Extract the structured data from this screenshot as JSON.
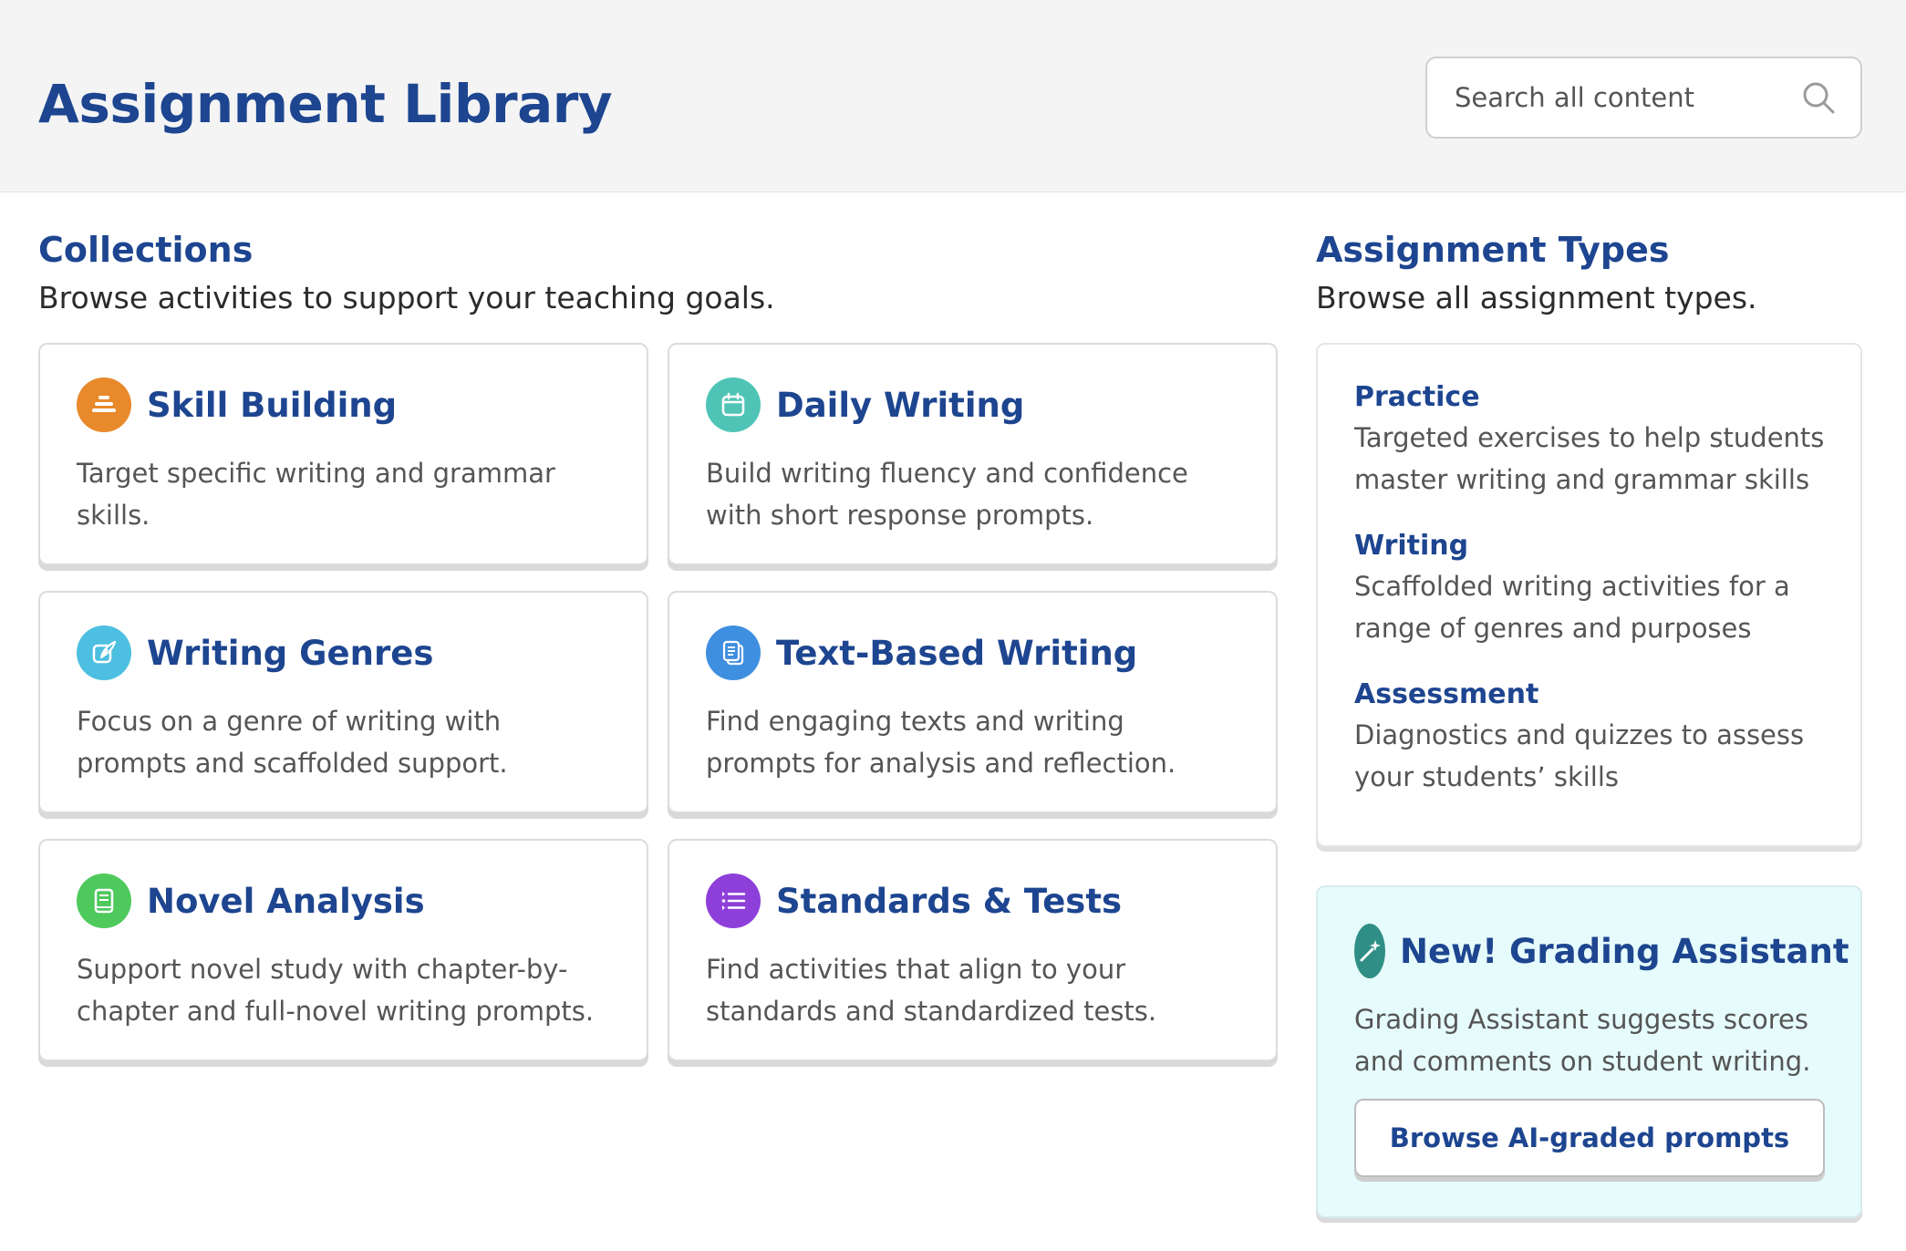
{
  "header": {
    "title": "Assignment Library",
    "search_placeholder": "Search all content"
  },
  "collections": {
    "title": "Collections",
    "subtitle": "Browse activities to support your teaching goals.",
    "cards": [
      {
        "title": "Skill Building",
        "description": "Target specific writing and grammar skills.",
        "icon": "layers-icon",
        "color": "#e8892b"
      },
      {
        "title": "Daily Writing",
        "description": "Build writing fluency and confidence with short response prompts.",
        "icon": "calendar-icon",
        "color": "#4fc4b6"
      },
      {
        "title": "Writing Genres",
        "description": "Focus on a genre of writing with prompts and scaffolded support.",
        "icon": "quill-icon",
        "color": "#4dbfe0"
      },
      {
        "title": "Text-Based Writing",
        "description": "Find engaging texts and writing prompts for analysis and reflection.",
        "icon": "documents-icon",
        "color": "#3f8fe0"
      },
      {
        "title": "Novel Analysis",
        "description": "Support novel study with chapter-by-chapter and full-novel writing prompts.",
        "icon": "book-icon",
        "color": "#4ec95c"
      },
      {
        "title": "Standards & Tests",
        "description": "Find activities that align to your standards and standardized tests.",
        "icon": "checklist-icon",
        "color": "#8e3fd9"
      }
    ]
  },
  "assignment_types": {
    "title": "Assignment Types",
    "subtitle": "Browse all assignment types.",
    "items": [
      {
        "title": "Practice",
        "description": "Targeted exercises to help students master writing and grammar skills"
      },
      {
        "title": "Writing",
        "description": "Scaffolded writing activities for a range of genres and purposes"
      },
      {
        "title": "Assessment",
        "description": "Diagnostics and quizzes to assess your students’ skills"
      }
    ]
  },
  "grading_assistant": {
    "title": "New! Grading Assistant",
    "description": "Grading Assistant suggests scores and comments on student writing.",
    "button_label": "Browse AI-graded prompts",
    "icon": "magic-wand-icon",
    "color": "#2f8f86"
  }
}
